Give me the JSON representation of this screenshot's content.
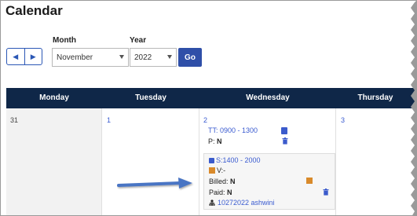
{
  "page": {
    "title": "Calendar"
  },
  "controls": {
    "month_label": "Month",
    "year_label": "Year",
    "month_value": "November",
    "year_value": "2022",
    "go_label": "Go"
  },
  "weekdays": [
    "Monday",
    "Tuesday",
    "Wednesday",
    "Thursday"
  ],
  "days": {
    "mon": "31",
    "tue": "1",
    "wed": "2",
    "thu": "3"
  },
  "events": {
    "first": {
      "time": "TT: 0900 - 1300",
      "p_label": "P:",
      "p_value": "N"
    },
    "second": {
      "time": "S:1400 - 2000",
      "v_label": "V:-",
      "billed_label": "Billed:",
      "billed_value": "N",
      "paid_label": "Paid:",
      "paid_value": "N",
      "user": "10272022 ashwini"
    }
  },
  "colors": {
    "header_bg": "#0f2748",
    "accent": "#2f4fa8",
    "link": "#3a5bd0",
    "arrow": "#4a74c4"
  }
}
